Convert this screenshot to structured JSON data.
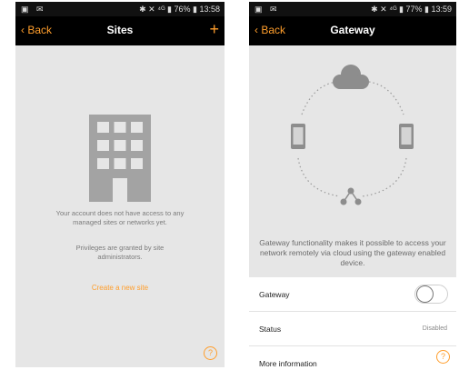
{
  "left_screen": {
    "status": {
      "icons_left": "▣ ✉",
      "right": "✱ ✕ ⁴ᴳ ▮ 76% ▮ 13:58"
    },
    "nav": {
      "back_label": "Back",
      "title": "Sites",
      "add_label": "+"
    },
    "message": "Your account does not have access to any managed sites or networks yet.",
    "privileges": "Privileges are granted by site administrators.",
    "create_link": "Create a new site",
    "help_glyph": "?"
  },
  "right_screen": {
    "status": {
      "icons_left": "▣ ✉",
      "right": "✱ ✕ ⁴ᴳ ▮ 77% ▮ 13:59"
    },
    "nav": {
      "back_label": "Back",
      "title": "Gateway"
    },
    "description": "Gateway functionality makes it possible to access your network remotely via cloud using the gateway enabled device.",
    "rows": [
      {
        "label": "Gateway",
        "toggle_on": false
      },
      {
        "label": "Status",
        "value": "Disabled"
      },
      {
        "label": "More information"
      }
    ],
    "help_glyph": "?"
  },
  "colors": {
    "accent": "#ff9e2c",
    "background": "#e6e6e6",
    "navbar": "#000000"
  }
}
